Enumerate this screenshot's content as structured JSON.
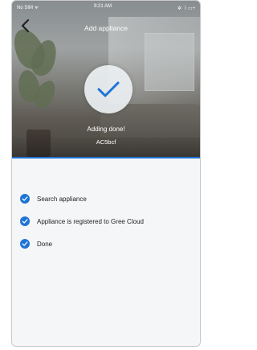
{
  "status_bar": {
    "carrier": "No SIM ᯤ",
    "time": "9:21 AM",
    "battery": "✲ 〡▭+"
  },
  "nav": {
    "title": "Add appliance",
    "back_icon": "chevron-left-icon"
  },
  "result": {
    "icon": "checkmark-icon",
    "message": "Adding done!",
    "device_name": "AC5bcf"
  },
  "steps": [
    {
      "label": "Search appliance",
      "icon": "check-circle-icon"
    },
    {
      "label": "Appliance is registered to Gree Cloud",
      "icon": "check-circle-icon"
    },
    {
      "label": "Done",
      "icon": "check-circle-icon"
    }
  ],
  "colors": {
    "accent": "#1e74d6",
    "screen_background": "#f5f6f8",
    "text": "#222222"
  }
}
